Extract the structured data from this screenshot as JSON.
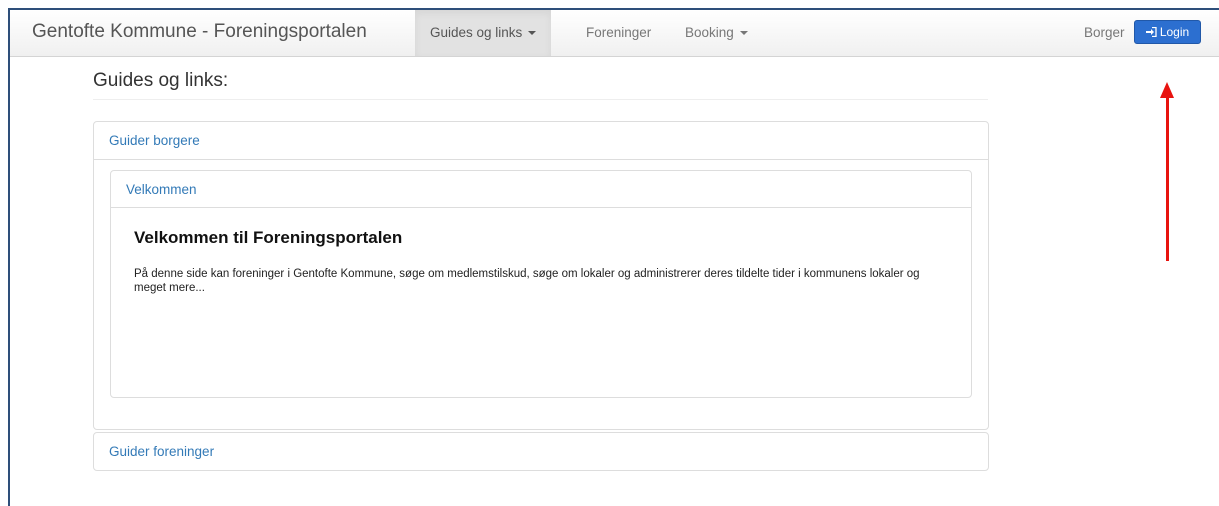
{
  "navbar": {
    "brand": "Gentofte Kommune - Foreningsportalen",
    "items": [
      {
        "label": "Guides og links",
        "dropdown": true,
        "active": true
      },
      {
        "label": "Foreninger",
        "dropdown": false,
        "active": false
      },
      {
        "label": "Booking",
        "dropdown": true,
        "active": false
      }
    ],
    "user_label": "Borger",
    "login_label": "Login",
    "login_icon": "sign-in-icon"
  },
  "page": {
    "title": "Guides og links:"
  },
  "panels": {
    "citizens": {
      "heading": "Guider borgere",
      "inner": {
        "heading": "Velkommen",
        "title": "Velkommen til Foreningsportalen",
        "body": "På denne side kan foreninger i Gentofte Kommune, søge om medlemstilskud, søge om lokaler og administrerer deres tildelte tider i kommunens lokaler og meget mere..."
      }
    },
    "associations": {
      "heading": "Guider foreninger"
    }
  },
  "colors": {
    "link": "#337ab7",
    "login_button": "#2c6fd0",
    "annotation_arrow": "#e8130f",
    "navbar_active": "#e2e2e2"
  }
}
